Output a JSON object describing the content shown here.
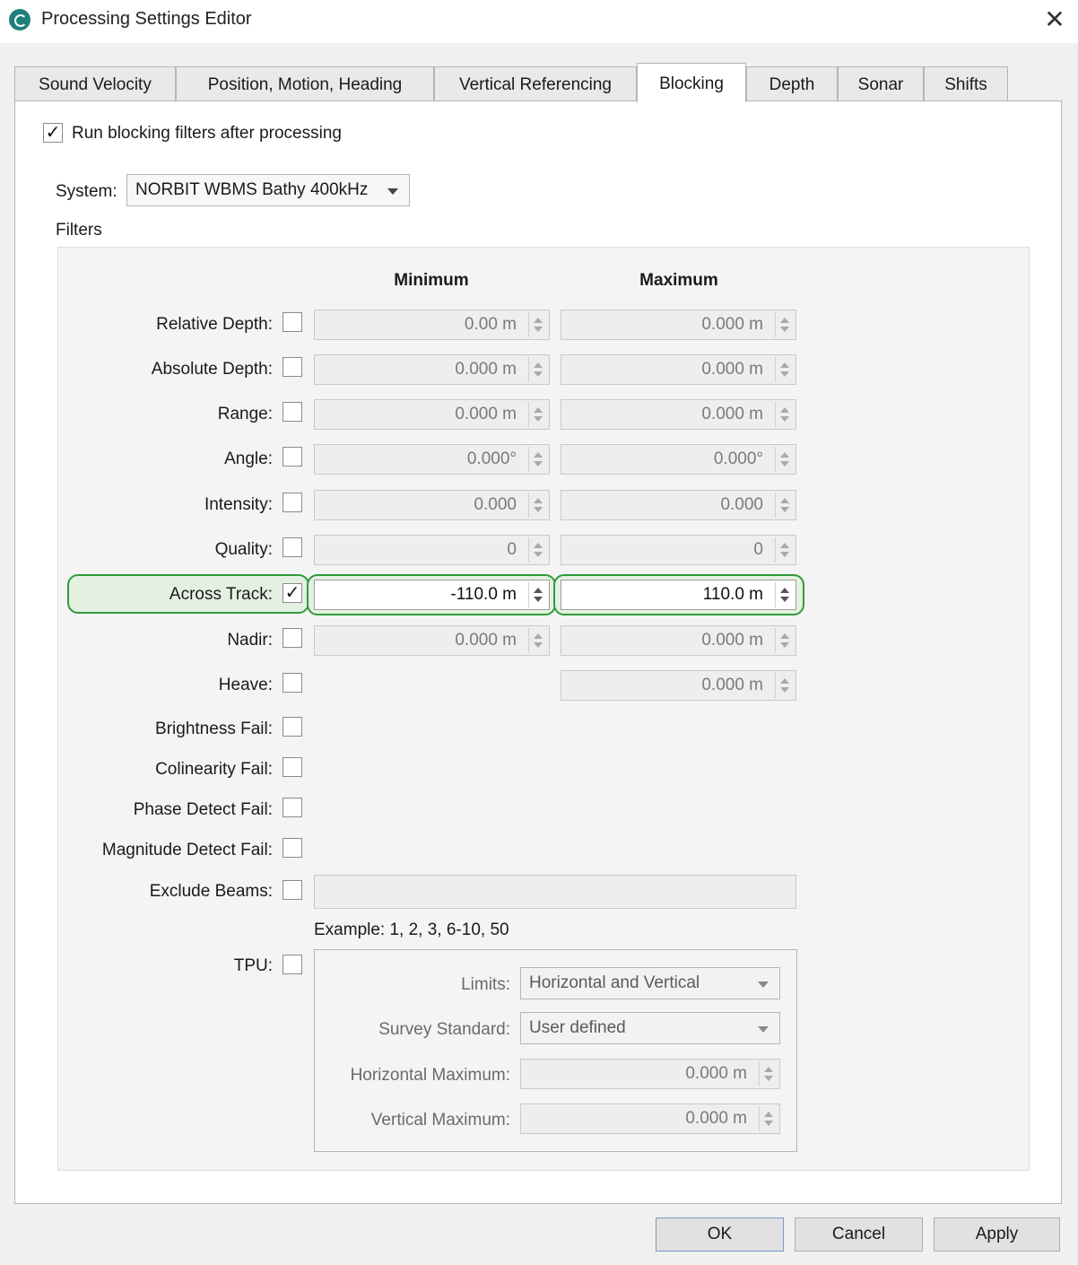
{
  "window": {
    "title": "Processing Settings Editor",
    "close_glyph": "✕"
  },
  "tabs": [
    {
      "label": "Sound Velocity"
    },
    {
      "label": "Position, Motion, Heading"
    },
    {
      "label": "Vertical Referencing"
    },
    {
      "label": "Blocking",
      "active": true
    },
    {
      "label": "Depth"
    },
    {
      "label": "Sonar"
    },
    {
      "label": "Shifts"
    }
  ],
  "blocking": {
    "run_after_label": "Run blocking filters after processing",
    "run_after_checked": true,
    "system_label": "System:",
    "system_value": "NORBIT WBMS Bathy 400kHz",
    "filters_label": "Filters",
    "minimum_header": "Minimum",
    "maximum_header": "Maximum",
    "check_glyph": "✓",
    "rows": {
      "relative_depth": {
        "label": "Relative Depth:",
        "checked": false,
        "min": "0.00 m",
        "max": "0.000 m"
      },
      "absolute_depth": {
        "label": "Absolute Depth:",
        "checked": false,
        "min": "0.000 m",
        "max": "0.000 m"
      },
      "range": {
        "label": "Range:",
        "checked": false,
        "min": "0.000 m",
        "max": "0.000 m"
      },
      "angle": {
        "label": "Angle:",
        "checked": false,
        "min": "0.000°",
        "max": "0.000°"
      },
      "intensity": {
        "label": "Intensity:",
        "checked": false,
        "min": "0.000",
        "max": "0.000"
      },
      "quality": {
        "label": "Quality:",
        "checked": false,
        "min": "0",
        "max": "0"
      },
      "across_track": {
        "label": "Across Track:",
        "checked": true,
        "min": "-110.0 m",
        "max": "110.0 m"
      },
      "nadir": {
        "label": "Nadir:",
        "checked": false,
        "min": "0.000 m",
        "max": "0.000 m"
      },
      "heave": {
        "label": "Heave:",
        "checked": false,
        "max": "0.000 m"
      },
      "brightness_fail": {
        "label": "Brightness Fail:",
        "checked": false
      },
      "colinearity_fail": {
        "label": "Colinearity Fail:",
        "checked": false
      },
      "phase_detect_fail": {
        "label": "Phase Detect Fail:",
        "checked": false
      },
      "magnitude_detect_fail": {
        "label": "Magnitude Detect Fail:",
        "checked": false
      },
      "exclude_beams": {
        "label": "Exclude Beams:",
        "checked": false,
        "value": "",
        "example": "Example: 1, 2, 3, 6-10, 50"
      },
      "tpu": {
        "label": "TPU:",
        "checked": false
      }
    },
    "tpu": {
      "limits_label": "Limits:",
      "limits_value": "Horizontal and Vertical",
      "standard_label": "Survey Standard:",
      "standard_value": "User defined",
      "hmax_label": "Horizontal Maximum:",
      "hmax_value": "0.000 m",
      "vmax_label": "Vertical Maximum:",
      "vmax_value": "0.000 m"
    }
  },
  "buttons": {
    "ok": "OK",
    "cancel": "Cancel",
    "apply": "Apply"
  },
  "colors": {
    "highlight_border": "#2f9a3c",
    "highlight_fill": "#e4f1e2",
    "app_icon": "#1f7f79"
  },
  "icons": {
    "app": "app-logo-icon",
    "close": "close-icon",
    "dropdown": "chevron-down-icon",
    "spin": "spin-arrows-icon"
  }
}
